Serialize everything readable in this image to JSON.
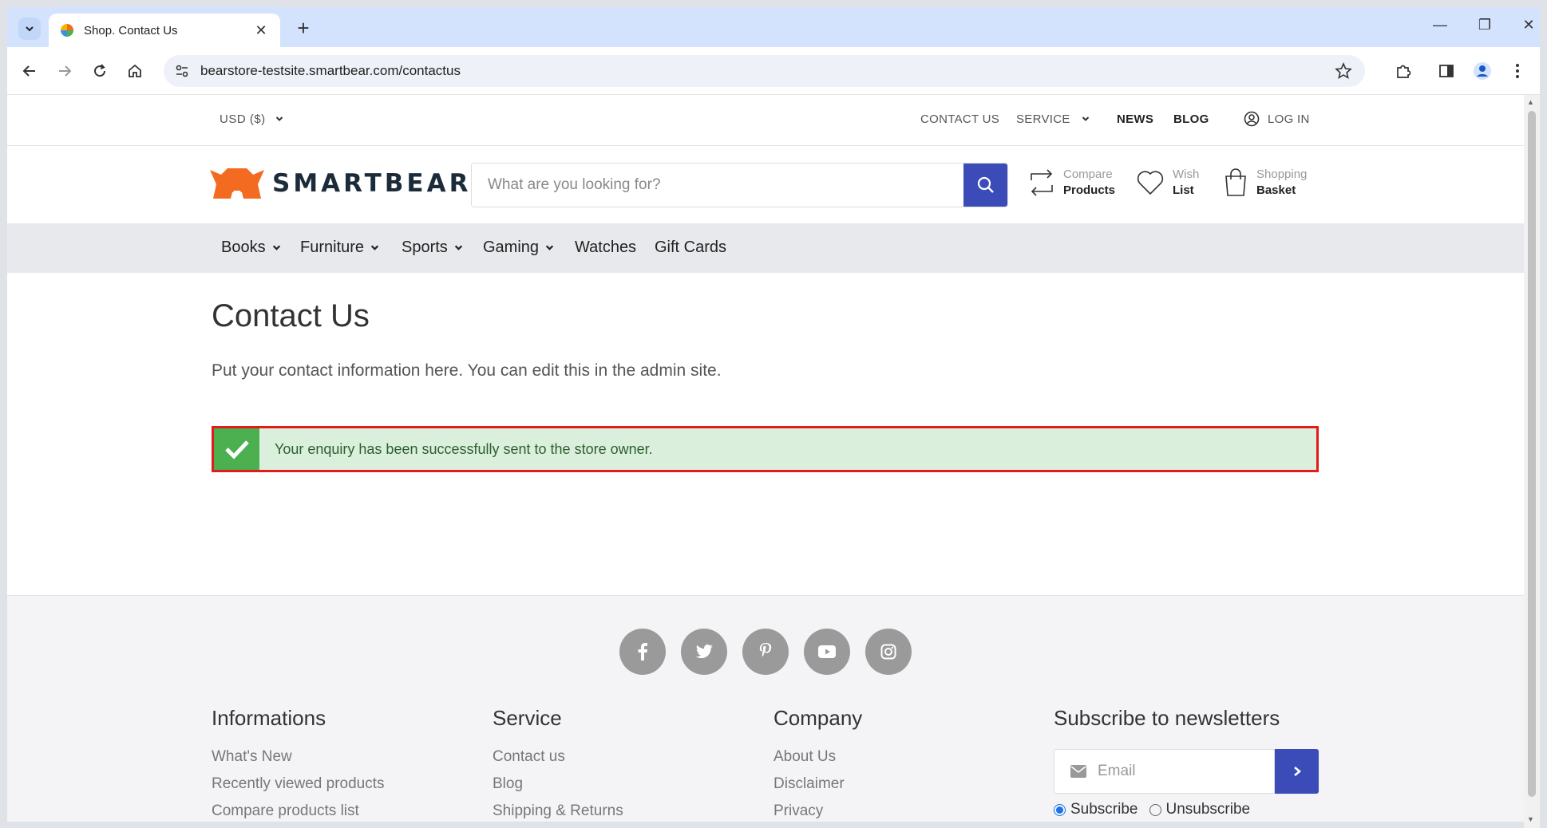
{
  "browser": {
    "tab_title": "Shop. Contact Us",
    "url": "bearstore-testsite.smartbear.com/contactus",
    "new_tab": "+",
    "tab_close": "✕",
    "minimize": "—",
    "restore": "❐",
    "close": "✕"
  },
  "topbar": {
    "currency": "USD  ($)",
    "contact": "CONTACT US",
    "service": "SERVICE",
    "news": "NEWS",
    "blog": "BLOG",
    "login": "LOG IN"
  },
  "header": {
    "logo_text": "SMARTBEAR",
    "search_placeholder": "What are you looking for?",
    "compare_a": "Compare",
    "compare_b": "Products",
    "wish_a": "Wish",
    "wish_b": "List",
    "basket_a": "Shopping",
    "basket_b": "Basket"
  },
  "categories": [
    "Books",
    "Furniture",
    "Sports",
    "Gaming",
    "Watches",
    "Gift Cards"
  ],
  "main": {
    "title": "Contact Us",
    "intro": "Put your contact information here. You can edit this in the admin site.",
    "alert": "Your enquiry has been successfully sent to the store owner."
  },
  "footer": {
    "social": [
      "facebook-icon",
      "twitter-icon",
      "pinterest-icon",
      "youtube-icon",
      "instagram-icon"
    ],
    "informations": {
      "title": "Informations",
      "links": [
        "What's New",
        "Recently viewed products",
        "Compare products list"
      ]
    },
    "service": {
      "title": "Service",
      "links": [
        "Contact us",
        "Blog",
        "Shipping & Returns"
      ]
    },
    "company": {
      "title": "Company",
      "links": [
        "About Us",
        "Disclaimer",
        "Privacy"
      ]
    },
    "newsletter": {
      "title": "Subscribe to newsletters",
      "placeholder": "Email",
      "subscribe": "Subscribe",
      "unsubscribe": "Unsubscribe"
    }
  },
  "colors": {
    "brand_orange": "#f26b21",
    "accent_blue": "#3b4cb8",
    "success_green": "#4caf50",
    "alert_border": "#e21b1b"
  }
}
